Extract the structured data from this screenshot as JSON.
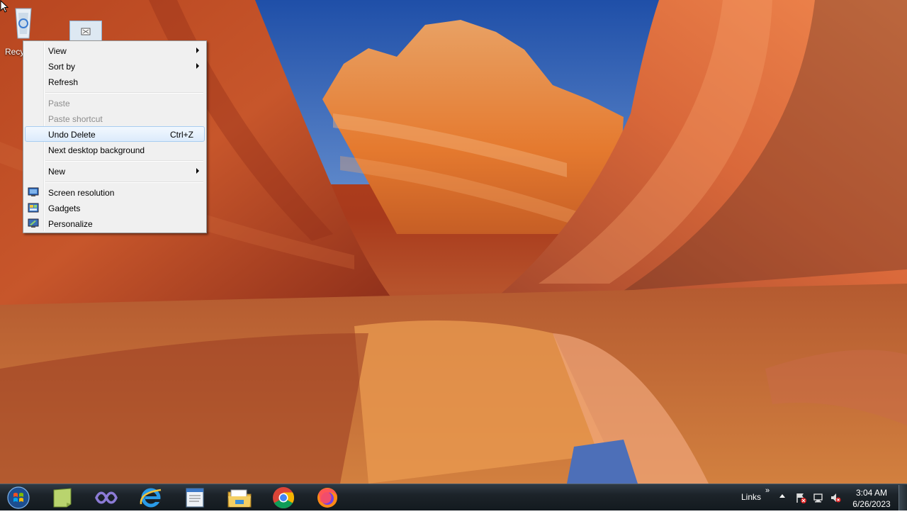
{
  "desktop": {
    "recycle_bin_label": "Recycle Bin"
  },
  "context_menu": {
    "items": [
      {
        "label": "View",
        "submenu": true
      },
      {
        "label": "Sort by",
        "submenu": true
      },
      {
        "label": "Refresh"
      },
      {
        "label": "Paste",
        "disabled": true
      },
      {
        "label": "Paste shortcut",
        "disabled": true
      },
      {
        "label": "Undo Delete",
        "shortcut": "Ctrl+Z",
        "highlighted": true
      },
      {
        "label": "Next desktop background"
      },
      {
        "label": "New",
        "submenu": true
      },
      {
        "label": "Screen resolution",
        "icon": "screen-resolution-icon"
      },
      {
        "label": "Gadgets",
        "icon": "gadgets-icon"
      },
      {
        "label": "Personalize",
        "icon": "personalize-icon"
      }
    ]
  },
  "taskbar": {
    "pinned": [
      "sticky-notes-icon",
      "visual-studio-icon",
      "internet-explorer-icon",
      "notepad-icon",
      "file-explorer-icon",
      "chrome-icon",
      "firefox-icon"
    ],
    "links_label": "Links",
    "links_chevron": "»",
    "time": "3:04 AM",
    "date": "6/26/2023"
  },
  "colors": {
    "menu_bg": "#f0f0f0",
    "menu_highlight_border": "#a8cdf1",
    "disabled_text": "#8d8d8d",
    "taskbar": "#1c2329"
  }
}
